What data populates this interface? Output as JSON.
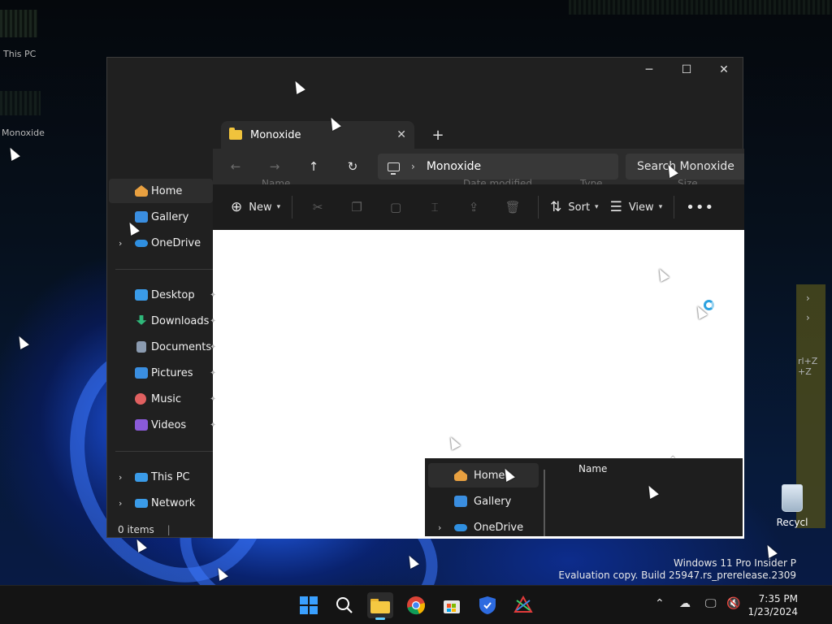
{
  "desktop": {
    "ghost_labels": [
      "This PC",
      "Monoxide"
    ],
    "watermark_line1": "Windows 11 Pro Insider P",
    "watermark_line2": "Evaluation copy. Build 25947.rs_prerelease.2309",
    "recycle_label": "Recycl",
    "ghost_panel_keys": [
      "rl+Z",
      "+Z"
    ]
  },
  "window": {
    "tab_title": "Monoxide",
    "address_crumb": "Monoxide",
    "search_placeholder": "Search Monoxide",
    "ghost_headers": [
      "Name",
      "Date modified",
      "Type",
      "Size"
    ],
    "toolbar": {
      "new_label": "New",
      "sort_label": "Sort",
      "view_label": "View"
    },
    "sidebar": {
      "items": [
        {
          "label": "Home",
          "icon": "home-icon",
          "color": "#e8a040"
        },
        {
          "label": "Gallery",
          "icon": "gallery-icon",
          "color": "#3a8ee0"
        },
        {
          "label": "OneDrive",
          "icon": "cloud-icon",
          "color": "#2f8fe0"
        },
        {
          "label": "Desktop",
          "icon": "desktop-icon",
          "color": "#3a9be8"
        },
        {
          "label": "Downloads",
          "icon": "download-icon",
          "color": "#2fb87a"
        },
        {
          "label": "Documents",
          "icon": "document-icon",
          "color": "#8b9bb0"
        },
        {
          "label": "Pictures",
          "icon": "pictures-icon",
          "color": "#3a8ee0"
        },
        {
          "label": "Music",
          "icon": "music-icon",
          "color": "#e06060"
        },
        {
          "label": "Videos",
          "icon": "video-icon",
          "color": "#8a5ad8"
        },
        {
          "label": "This PC",
          "icon": "computer-icon",
          "color": "#3a9be8"
        },
        {
          "label": "Network",
          "icon": "network-icon",
          "color": "#3a9be8"
        }
      ]
    },
    "status_text": "0 items"
  },
  "ghost_sidebar": {
    "items": [
      "Home",
      "Gallery",
      "OneDrive"
    ],
    "column_header": "Name"
  },
  "taskbar": {
    "time": "7:35 PM",
    "date": "1/23/2024"
  }
}
